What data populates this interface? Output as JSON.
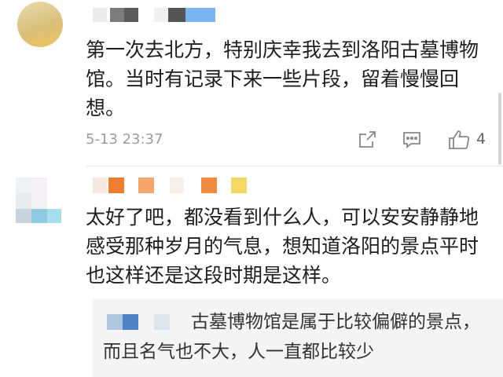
{
  "comments": [
    {
      "text": "第一次去北方，特别庆幸我去到洛阳古墓博物馆。当时有记录下来一些片段，留着慢慢回想。",
      "timestamp": "5-13 23:37",
      "like_count": "4",
      "actions": [
        "share-icon",
        "comment-icon",
        "like-icon"
      ]
    },
    {
      "text": "太好了吧，都没看到什么人，可以安安静静地感受那种岁月的气息，想知道洛阳的景点平时也这样还是这段时期是这样。",
      "reply": {
        "text": "古墓博物馆是属于比较偏僻的景点，而且名气也不大，人一直都比较少"
      }
    }
  ],
  "colors": {
    "timestamp": "#9c9c9c",
    "reply_background": "#f4f4f4",
    "icon": "#888888",
    "divider": "#e6e6e6"
  }
}
